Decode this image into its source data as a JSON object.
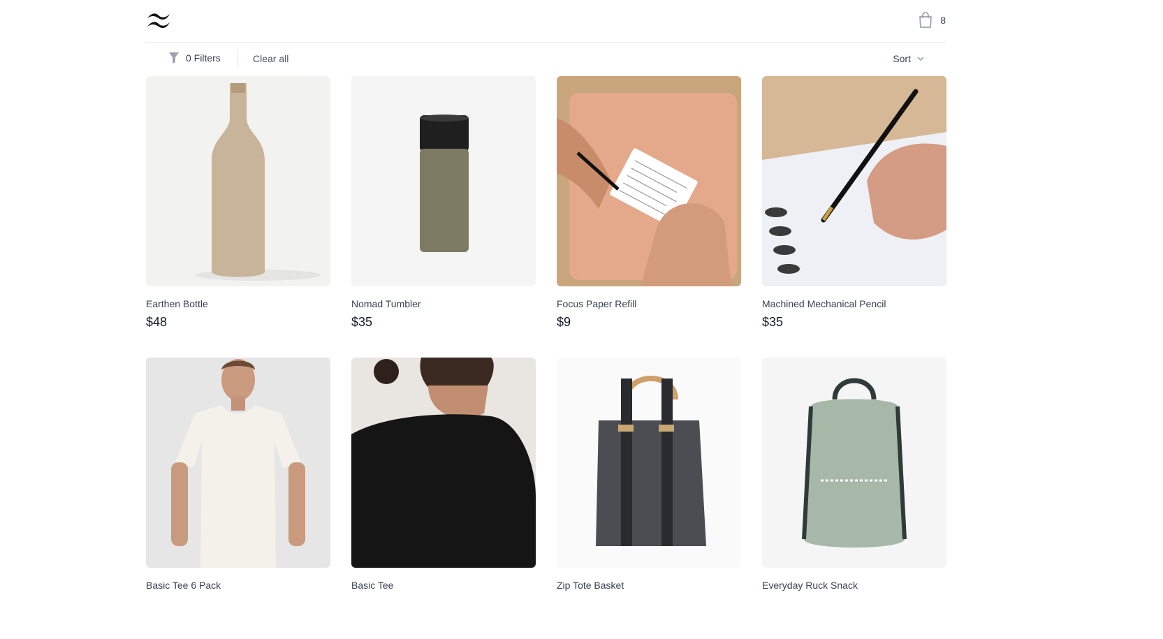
{
  "header": {
    "logo_icon": "wave-logo-icon",
    "cart_icon": "shopping-bag-icon",
    "cart_count": "8"
  },
  "filters": {
    "filter_icon": "funnel-icon",
    "filters_label": "0 Filters",
    "clear_label": "Clear all",
    "sort_label": "Sort",
    "sort_icon": "chevron-down-icon"
  },
  "products": [
    {
      "name": "Earthen Bottle",
      "price": "$48"
    },
    {
      "name": "Nomad Tumbler",
      "price": "$35"
    },
    {
      "name": "Focus Paper Refill",
      "price": "$9"
    },
    {
      "name": "Machined Mechanical Pencil",
      "price": "$35"
    },
    {
      "name": "Basic Tee 6 Pack",
      "price": ""
    },
    {
      "name": "Basic Tee",
      "price": ""
    },
    {
      "name": "Zip Tote Basket",
      "price": ""
    },
    {
      "name": "Everyday Ruck Snack",
      "price": ""
    }
  ]
}
